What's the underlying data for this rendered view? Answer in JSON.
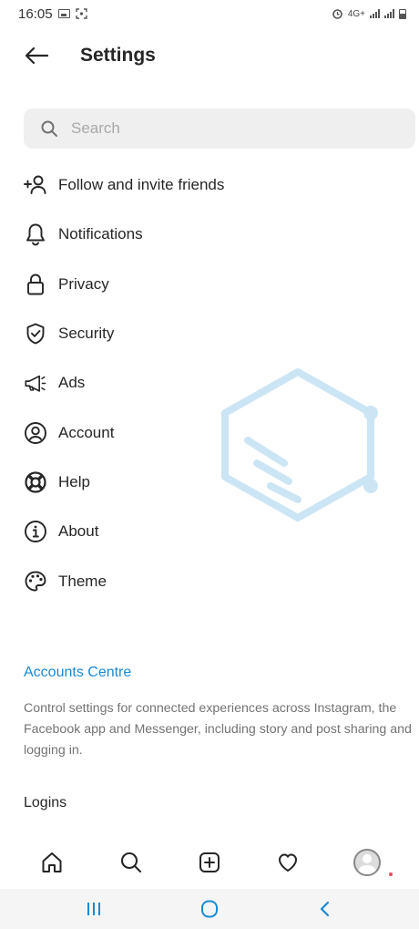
{
  "status_bar": {
    "time": "16:05",
    "network": "4G+",
    "icons": [
      "gallery-icon",
      "screenshot-icon",
      "alarm-icon",
      "signal-icon",
      "battery-icon"
    ]
  },
  "header": {
    "back_icon": "arrow-left-icon",
    "title": "Settings"
  },
  "search": {
    "placeholder": "Search",
    "value": "",
    "icon": "search-icon"
  },
  "menu": {
    "items": [
      {
        "label": "Follow and invite friends",
        "icon": "add-person-icon"
      },
      {
        "label": "Notifications",
        "icon": "bell-icon"
      },
      {
        "label": "Privacy",
        "icon": "lock-icon"
      },
      {
        "label": "Security",
        "icon": "shield-check-icon"
      },
      {
        "label": "Ads",
        "icon": "megaphone-icon"
      },
      {
        "label": "Account",
        "icon": "account-circle-icon"
      },
      {
        "label": "Help",
        "icon": "lifebuoy-icon"
      },
      {
        "label": "About",
        "icon": "info-icon"
      },
      {
        "label": "Theme",
        "icon": "palette-icon"
      }
    ]
  },
  "accounts_centre": {
    "title": "Accounts Centre",
    "description": "Control settings for connected experiences across Instagram, the Facebook app and Messenger, including story and post sharing and logging in."
  },
  "logins": {
    "title": "Logins"
  },
  "bottom_nav": {
    "items": [
      "home-icon",
      "search-icon",
      "new-post-icon",
      "heart-icon",
      "profile-avatar"
    ]
  },
  "system_nav": {
    "items": [
      "recent-apps-icon",
      "home-circle-icon",
      "back-chevron-icon"
    ]
  },
  "colors": {
    "link": "#1a8ad4",
    "text": "#262626",
    "muted": "#737373",
    "search_bg": "#efefef",
    "notification_dot": "#ed4956"
  }
}
